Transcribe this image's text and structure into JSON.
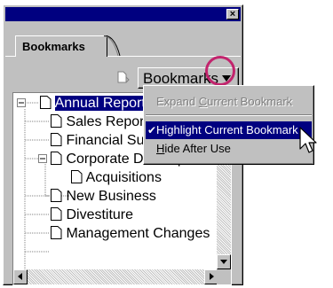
{
  "palette": {
    "close_glyph": "×",
    "tab_label": "Bookmarks",
    "menu_button_label": "Bookmarks"
  },
  "tree": {
    "items": [
      {
        "label": "Annual Report",
        "expander": "minus",
        "selected": true
      },
      {
        "label": "Sales Report"
      },
      {
        "label": "Financial Summary"
      },
      {
        "label": "Corporate Development",
        "expander": "minus"
      },
      {
        "label": "Acquisitions"
      },
      {
        "label": "New Business"
      },
      {
        "label": "Divestiture"
      },
      {
        "label": "Management Changes"
      }
    ]
  },
  "menu": {
    "expand_pre": "Expand ",
    "expand_u": "C",
    "expand_post": "urrent Bookmark",
    "highlight_pre": "Highlight Current Bookmark",
    "hide_u": "H",
    "hide_post": "ide After Use",
    "check_glyph": "✔"
  },
  "colors": {
    "title_bar": "#000080",
    "selection": "#000080",
    "annotation_circle": "#c2246d",
    "chrome": "#c0c0c0"
  }
}
